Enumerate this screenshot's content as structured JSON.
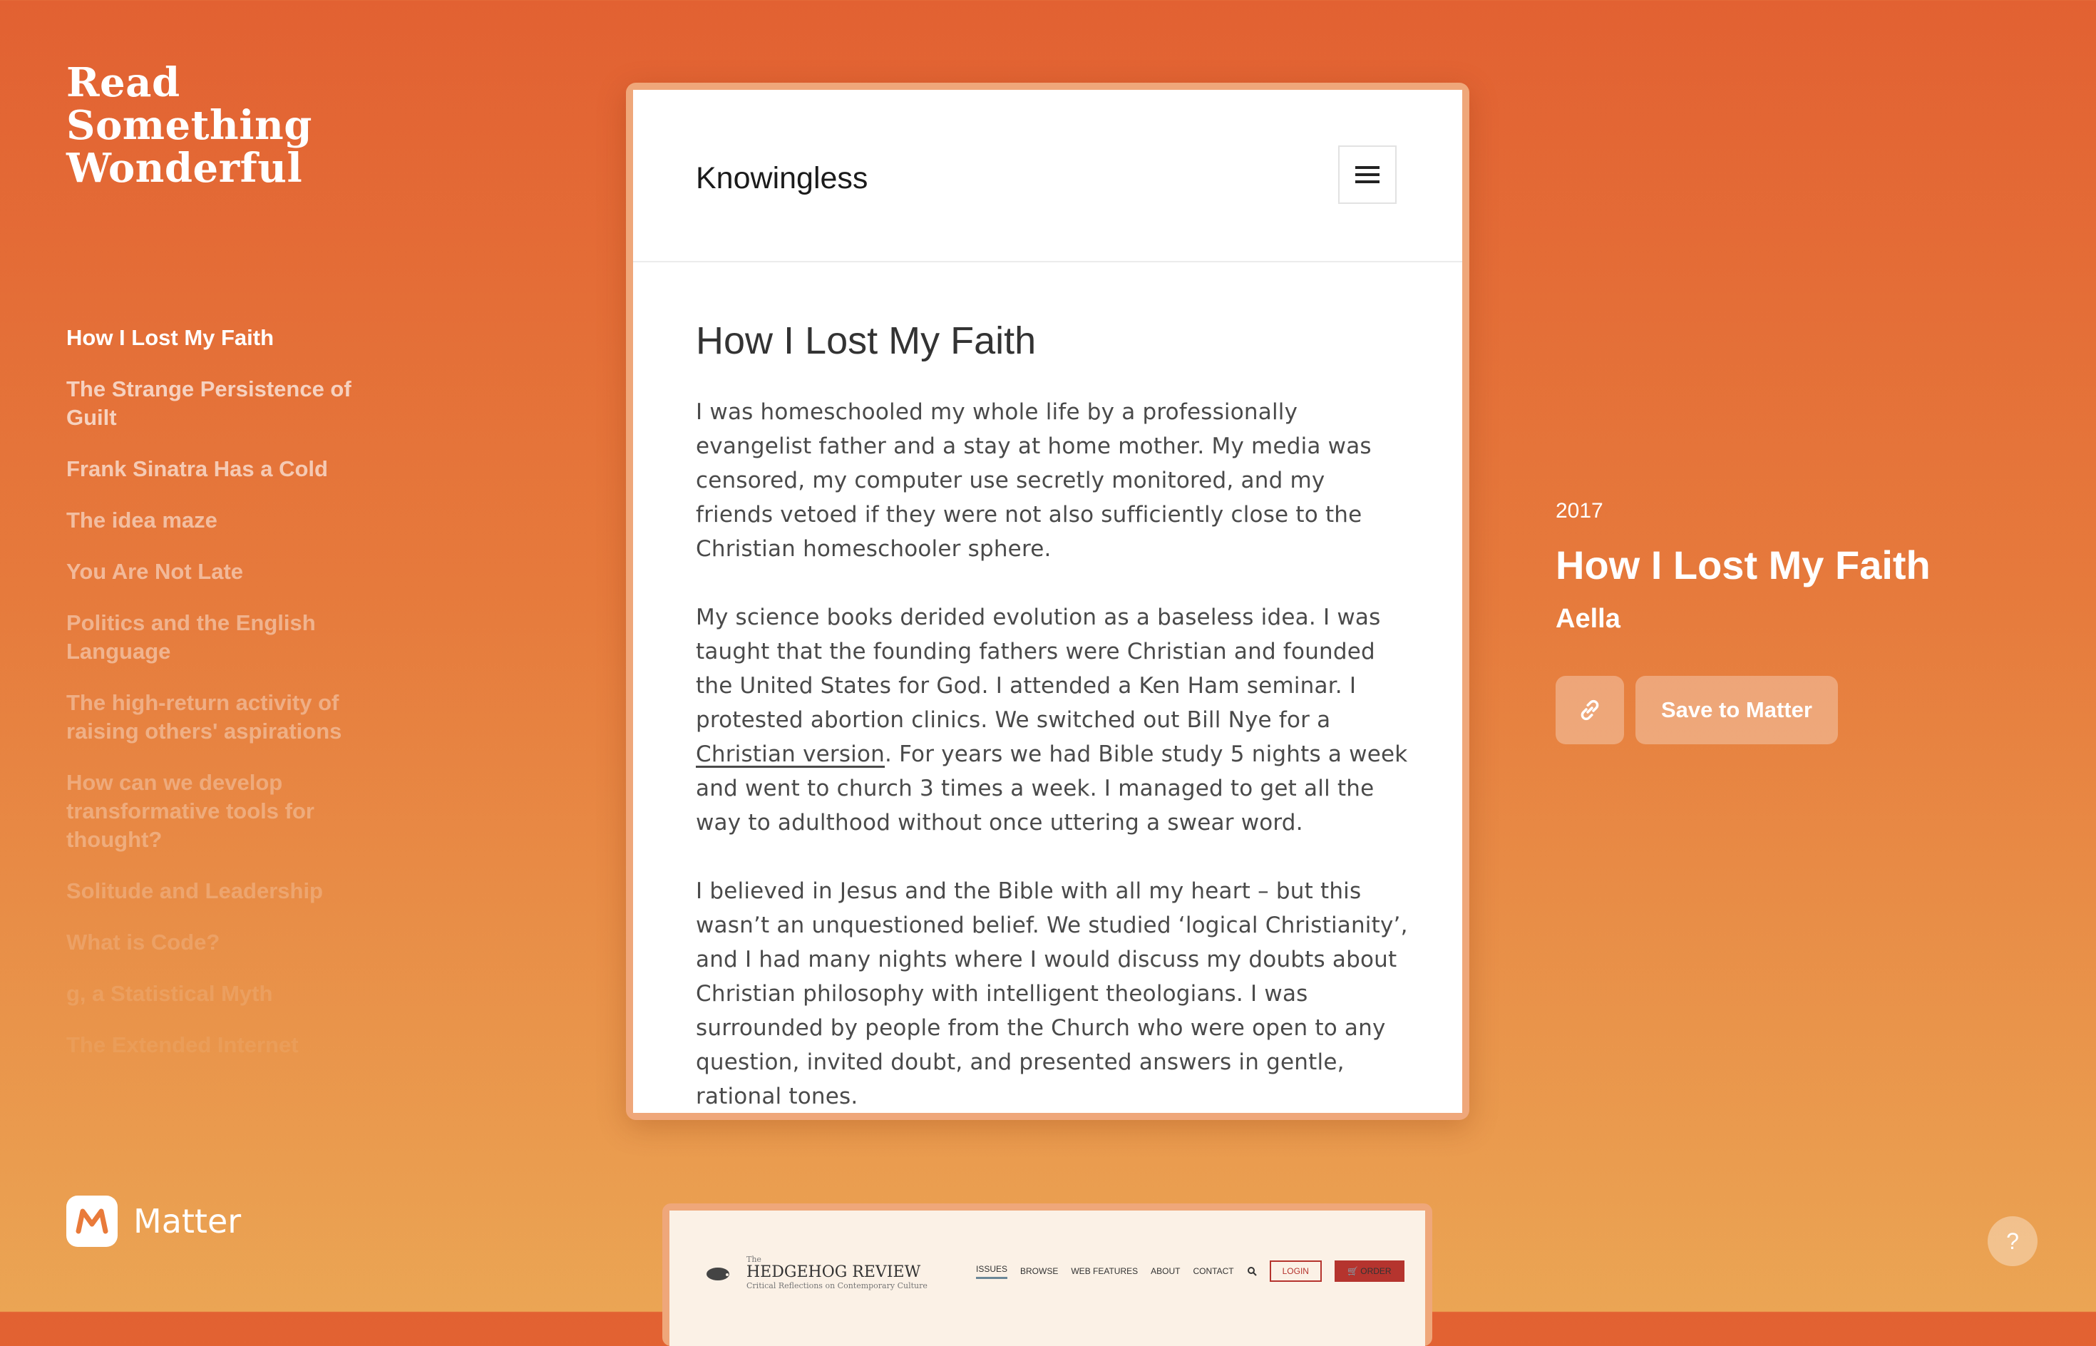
{
  "brand": {
    "title_lines": [
      "Read",
      "Something",
      "Wonderful"
    ]
  },
  "sidebar": {
    "articles": [
      "How I Lost My Faith",
      "The Strange Persistence of Guilt",
      "Frank Sinatra Has a Cold",
      "The idea maze",
      "You Are Not Late",
      "Politics and the English Language",
      "The high-return activity of raising others' aspirations",
      "How can we develop transformative tools for thought?",
      "Solitude and Leadership",
      "What is Code?",
      "g, a Statistical Myth",
      "The Extended Internet"
    ],
    "article_opacity": [
      1.0,
      0.68,
      0.62,
      0.52,
      0.48,
      0.42,
      0.36,
      0.3,
      0.22,
      0.16,
      0.12,
      0.08
    ]
  },
  "matter": {
    "name": "Matter"
  },
  "reader": {
    "site_title": "Knowingless",
    "article_title": "How I Lost My Faith",
    "paragraphs": {
      "p1": "I was homeschooled my whole life by a professionally evangelist father and a stay at home mother. My media was censored, my computer use secretly monitored, and my friends vetoed if they were not also sufficiently close to the Christian homeschooler sphere.",
      "p2_before": "My science books derided evolution as a baseless idea. I was taught that the founding fathers were Christian and founded the United States for God. I attended a Ken Ham seminar. I protested abortion clinics. We switched out Bill Nye for a ",
      "p2_link": "Christian version",
      "p2_after": ". For years we had Bible study 5 nights a week and went to church 3 times a week. I managed to get all the way to adulthood without once uttering a swear word.",
      "p3": "I believed in Jesus and the Bible with all my heart – but this wasn’t an unquestioned belief. We studied ‘logical Christianity’, and I had many nights where I would discuss my doubts about Christian philosophy with intelligent theologians. I was surrounded by people from the Church who were open to any question, invited doubt, and presented answers in gentle, rational tones."
    }
  },
  "preview": {
    "logo_small": "The",
    "logo_title": "HEDGEHOG REVIEW",
    "logo_sub": "Critical Reflections on Contemporary Culture",
    "nav": [
      "ISSUES",
      "BROWSE",
      "WEB FEATURES",
      "ABOUT",
      "CONTACT"
    ],
    "login": "LOGIN",
    "order": "ORDER"
  },
  "meta": {
    "year": "2017",
    "title": "How I Lost My Faith",
    "author": "Aella",
    "save_label": "Save to Matter"
  },
  "help": {
    "label": "?"
  },
  "icons": {
    "link": "link-icon",
    "menu": "hamburger-menu-icon",
    "search": "search-icon",
    "cart": "cart-icon",
    "matter": "matter-logo-icon"
  },
  "colors": {
    "accent": "#e26132",
    "preview_button": "#b5342e"
  }
}
